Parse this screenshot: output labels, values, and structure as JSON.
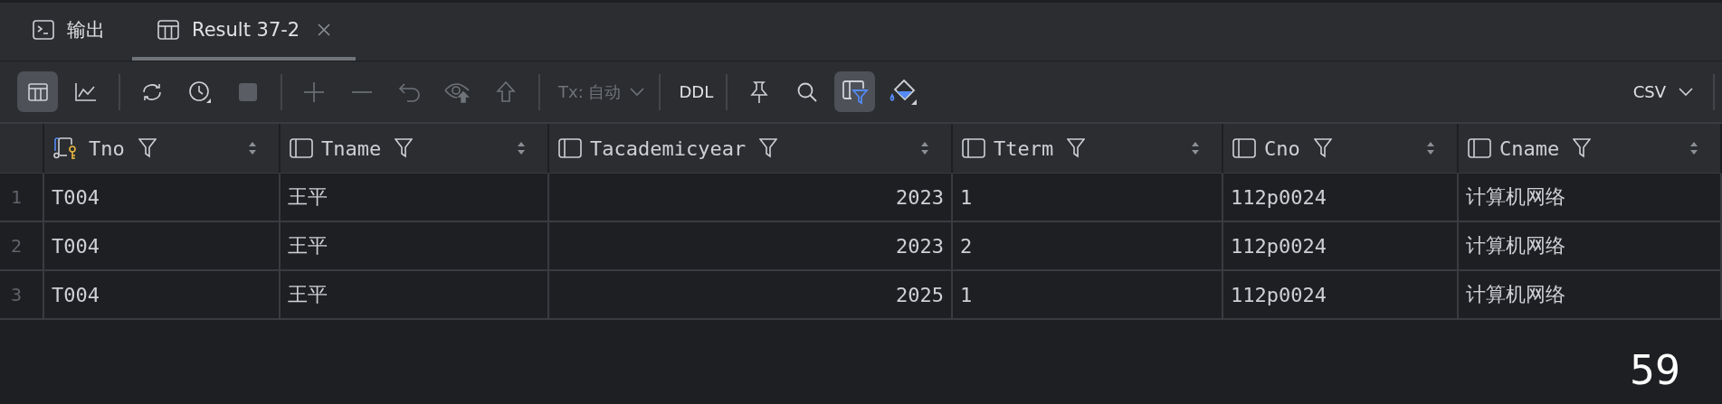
{
  "tabs": [
    {
      "label": "输出",
      "kind": "console",
      "selected": false
    },
    {
      "label": "Result 37-2",
      "kind": "table",
      "selected": true,
      "closable": true
    }
  ],
  "toolbar": {
    "groups": [
      [
        {
          "kind": "grid",
          "selected": true,
          "disabled": false
        },
        {
          "kind": "chart",
          "selected": false,
          "disabled": false
        }
      ],
      [
        {
          "kind": "refresh",
          "selected": false,
          "disabled": false
        },
        {
          "kind": "history",
          "selected": false,
          "disabled": false
        },
        {
          "kind": "stop",
          "selected": false,
          "disabled": true
        }
      ],
      [
        {
          "kind": "add",
          "selected": false,
          "disabled": true
        },
        {
          "kind": "remove",
          "selected": false,
          "disabled": true
        },
        {
          "kind": "revert",
          "selected": false,
          "disabled": true
        },
        {
          "kind": "preview",
          "selected": false,
          "disabled": true
        },
        {
          "kind": "submit",
          "selected": false,
          "disabled": true
        }
      ]
    ],
    "tx_mode": {
      "label": "Tx: 自动",
      "disabled": true
    },
    "ddl_button": "DDL",
    "tools": [
      {
        "kind": "pin",
        "selected": false
      },
      {
        "kind": "search",
        "selected": false
      },
      {
        "kind": "filter",
        "selected": true
      },
      {
        "kind": "paint",
        "selected": false
      }
    ],
    "export_format": "CSV"
  },
  "table": {
    "columns": [
      {
        "name": "Tno",
        "key": true,
        "numeric": false
      },
      {
        "name": "Tname",
        "key": false,
        "numeric": false
      },
      {
        "name": "Tacademicyear",
        "key": false,
        "numeric": true
      },
      {
        "name": "Tterm",
        "key": false,
        "numeric": false
      },
      {
        "name": "Cno",
        "key": false,
        "numeric": false
      },
      {
        "name": "Cname",
        "key": false,
        "numeric": false
      }
    ],
    "rows": [
      {
        "number": "1",
        "cells": [
          "T004",
          "王平",
          "2023",
          "1",
          "112p0024",
          "计算机网络"
        ]
      },
      {
        "number": "2",
        "cells": [
          "T004",
          "王平",
          "2023",
          "2",
          "112p0024",
          "计算机网络"
        ]
      },
      {
        "number": "3",
        "cells": [
          "T004",
          "王平",
          "2025",
          "1",
          "112p0024",
          "计算机网络"
        ]
      }
    ]
  },
  "overlay_number": "59"
}
